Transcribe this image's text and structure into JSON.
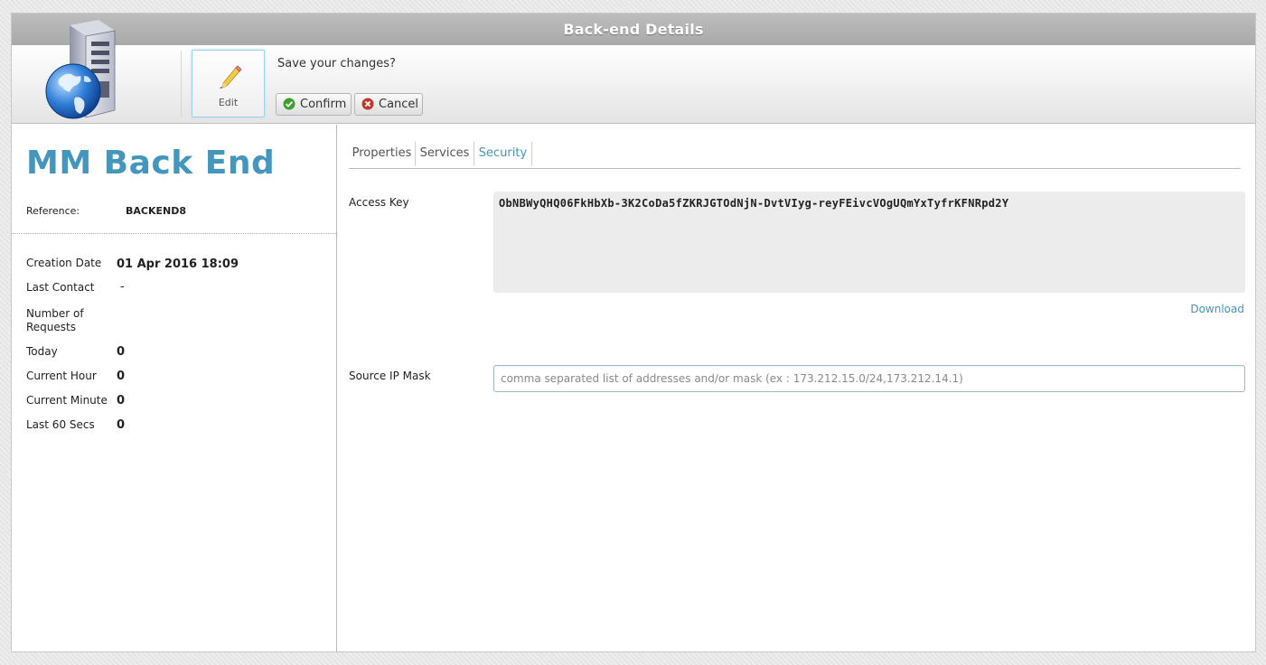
{
  "window": {
    "title": "Back-end Details"
  },
  "toolbar": {
    "edit_label": "Edit",
    "save_prompt": "Save your changes?",
    "confirm_label": "Confirm",
    "cancel_label": "Cancel"
  },
  "backend": {
    "name": "MM Back End",
    "reference_label": "Reference:",
    "reference_value": "BACKEND8"
  },
  "stats": [
    {
      "label": "Creation Date",
      "value": "01 Apr 2016 18:09"
    },
    {
      "label": "Last Contact",
      "value": "-"
    },
    {
      "label": "Number of Requests",
      "value": ""
    },
    {
      "label": "Today",
      "value": "0"
    },
    {
      "label": "Current Hour",
      "value": "0"
    },
    {
      "label": "Current Minute",
      "value": "0"
    },
    {
      "label": "Last 60 Secs",
      "value": "0"
    }
  ],
  "tabs": [
    {
      "label": "Properties",
      "active": false
    },
    {
      "label": "Services",
      "active": false
    },
    {
      "label": "Security",
      "active": true
    }
  ],
  "security": {
    "access_key_label": "Access Key",
    "access_key_value": "ObNBWyQHQ06FkHbXb-3K2CoDa5fZKRJGTOdNjN-DvtVIyg-reyFEivcVOgUQmYxTyfrKFNRpd2Y",
    "download_label": "Download",
    "source_ip_label": "Source IP Mask",
    "source_ip_value": "",
    "source_ip_placeholder": "comma separated list of addresses and/or mask (ex : 173.212.15.0/24,173.212.14.1)"
  },
  "icons": {
    "logo": "server-globe-icon",
    "edit": "pencil-icon",
    "confirm": "check-circle-icon",
    "cancel": "x-circle-icon"
  },
  "colors": {
    "accent": "#4496bc",
    "confirm": "#3aa132",
    "cancel": "#c0392b"
  }
}
